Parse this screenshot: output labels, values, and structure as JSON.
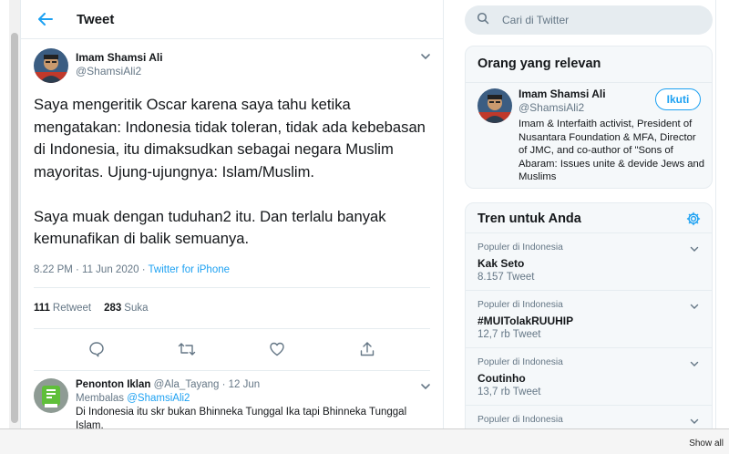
{
  "header": {
    "title": "Tweet"
  },
  "tweet": {
    "author_name": "Imam Shamsi Ali",
    "author_handle": "@ShamsiAli2",
    "text_para1": "Saya mengeritik Oscar karena saya tahu ketika mengatakan: Indonesia tidak toleran, tidak ada kebebasan di Indonesia, itu dimaksudkan sebagai negara Muslim mayoritas. Ujung-ujungnya: Islam/Muslim.",
    "text_para2": "Saya muak dengan tuduhan2 itu. Dan terlalu banyak kemunafikan di balik semuanya.",
    "timestamp": "8.22 PM · 11 Jun 2020 · ",
    "source": "Twitter for iPhone",
    "retweet_count": "111",
    "retweet_label": "Retweet",
    "like_count": "283",
    "like_label": "Suka"
  },
  "reply": {
    "name": "Penonton Iklan",
    "handle_date": "@Ala_Tayang · 12 Jun",
    "replying_prefix": "Membalas ",
    "replying_handle": "@ShamsiAli2",
    "text": "Di Indonesia itu skr bukan Bhinneka Tunggal Ika tapi Bhinneka Tunggal Islam."
  },
  "search": {
    "placeholder": "Cari di Twitter"
  },
  "relevant": {
    "title": "Orang yang relevan",
    "name": "Imam Shamsi Ali",
    "handle": "@ShamsiAli2",
    "follow_label": "Ikuti",
    "bio": "Imam & Interfaith activist, President of Nusantara Foundation & MFA, Director of JMC, and co-author of \"Sons of Abaram: Issues unite & devide Jews and Muslims"
  },
  "trends": {
    "title": "Tren untuk Anda",
    "items": [
      {
        "context": "Populer di Indonesia",
        "name": "Kak Seto",
        "count": "8.157 Tweet"
      },
      {
        "context": "Populer di Indonesia",
        "name": "#MUITolakRUUHIP",
        "count": "12,7 rb Tweet"
      },
      {
        "context": "Populer di Indonesia",
        "name": "Coutinho",
        "count": "13,7 rb Tweet"
      },
      {
        "context": "Populer di Indonesia",
        "name": "",
        "count": ""
      }
    ]
  },
  "bottom": {
    "show_all": "Show all"
  },
  "colors": {
    "accent": "#1da1f2",
    "secondary_text": "#657786",
    "border": "#e6ecf0"
  },
  "icons": [
    "back-arrow-icon",
    "chevron-down-icon",
    "reply-icon",
    "retweet-icon",
    "like-icon",
    "share-icon",
    "search-icon",
    "gear-icon"
  ]
}
